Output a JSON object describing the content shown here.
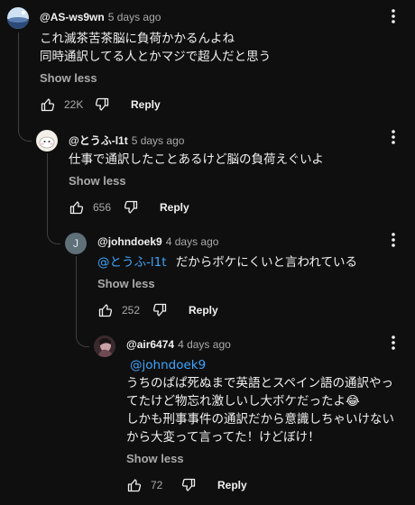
{
  "comments": [
    {
      "author": "@AS-ws9wn",
      "time": "5 days ago",
      "lines": [
        "これ滅茶苦茶脳に負荷かかるんよね",
        "同時通訳してる人とかマジで超人だと思う"
      ],
      "show_less": "Show less",
      "likes": "22K",
      "reply": "Reply"
    },
    {
      "author": "@とうふ-l1t",
      "time": "5 days ago",
      "lines": [
        "仕事で通訳したことあるけど脳の負荷えぐいよ"
      ],
      "show_less": "Show less",
      "likes": "656",
      "reply": "Reply"
    },
    {
      "author": "@johndoek9",
      "time": "4 days ago",
      "avatar_letter": "J",
      "mention": "@とうふ-l1t",
      "text": "だからボケにくいと言われている",
      "show_less": "Show less",
      "likes": "252",
      "reply": "Reply"
    },
    {
      "author": "@air6474",
      "time": "4 days ago",
      "mention": "@johndoek9",
      "lines": [
        "うちのぱぱ死ぬまで英語とスペイン語の通訳やっ",
        "てたけど物忘れ激しいし大ボケだったよ😂",
        "しかも刑事事件の通訳だから意識しちゃいけない",
        "から大変って言ってた！けどぼけ！"
      ],
      "show_less": "Show less",
      "likes": "72",
      "reply": "Reply"
    }
  ],
  "colors": {
    "background": "#0f0f0f",
    "text": "#f1f1f1",
    "secondary": "#aaaaaa",
    "link": "#3ea6ff",
    "thread_line": "#3f3f3f"
  },
  "icons": [
    "like-icon",
    "dislike-icon",
    "more-vert-icon"
  ]
}
